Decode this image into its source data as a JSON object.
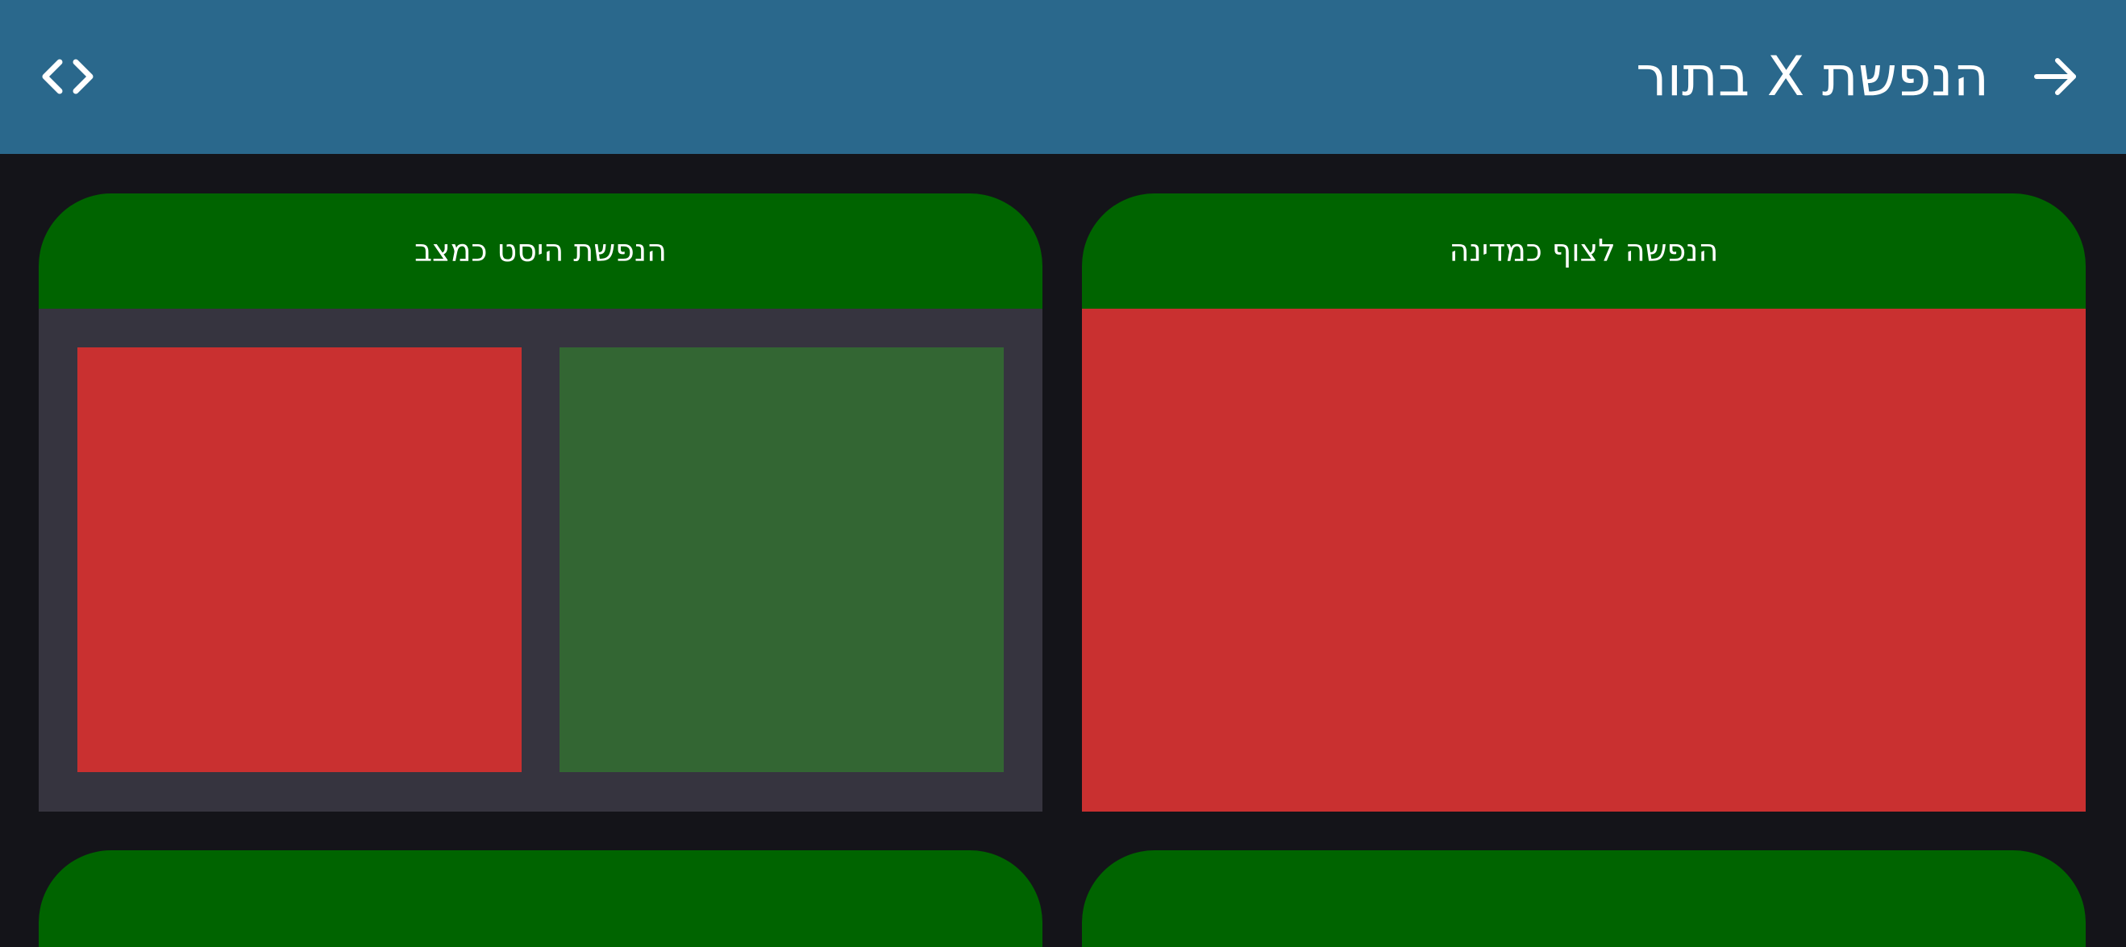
{
  "appbar": {
    "title": "הנפשת X בתור",
    "back_icon": "arrow-right-icon",
    "code_icon": "code-brackets-icon",
    "background_color": "#2a688c"
  },
  "cards": [
    {
      "title": "הנפשה לצוף כמדינה",
      "header_color": "#006400",
      "body_color": "#c93030"
    },
    {
      "title": "הנפשת היסט כמצב",
      "header_color": "#006400",
      "body_color": "#36343f",
      "tiles": [
        {
          "color": "#336633"
        },
        {
          "color": "#c93030"
        }
      ]
    }
  ],
  "colors": {
    "page_background": "#141419",
    "text": "#ffffff"
  }
}
